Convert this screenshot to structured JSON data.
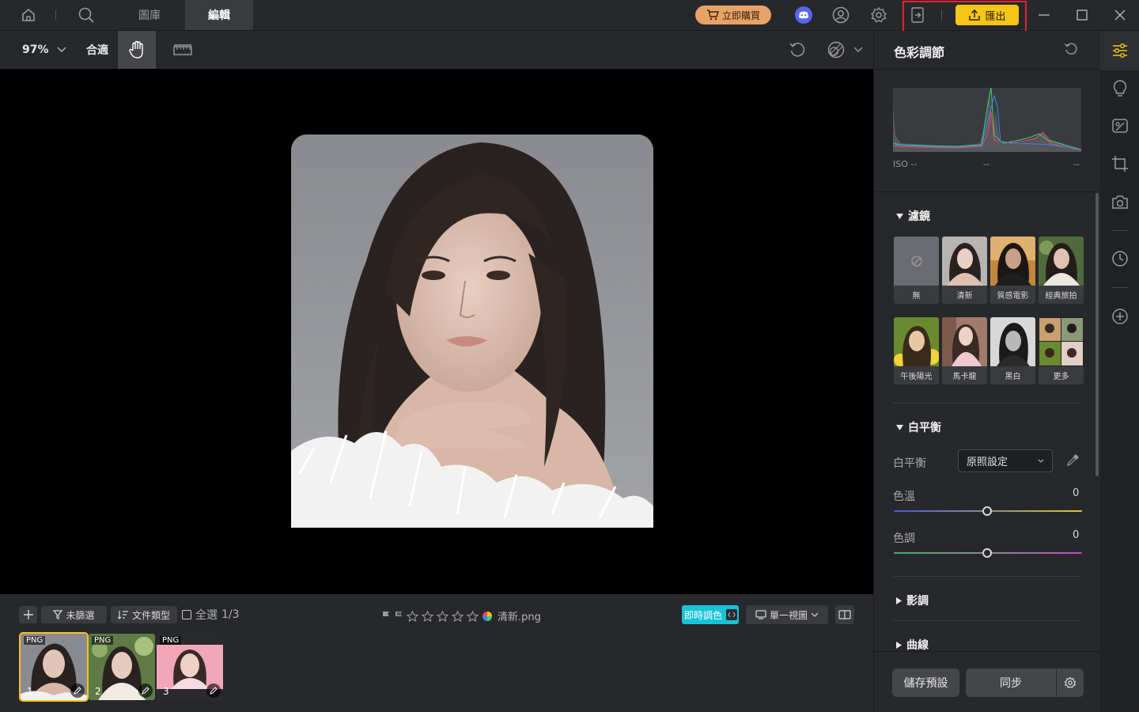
{
  "topbar": {
    "tabs": [
      {
        "label": "圖庫"
      },
      {
        "label": "編輯"
      }
    ],
    "buy_label": "立即購買",
    "export_label": "匯出"
  },
  "toolbar": {
    "zoom": "97%",
    "fit_label": "合適"
  },
  "bottom": {
    "filter_label": "未篩選",
    "filetype_label": "文件類型",
    "select_all_label": "全選",
    "select_count": "1/3",
    "filename": "清新.png",
    "live_color_label": "即時調色",
    "view_label": "單一視圖",
    "thumbnails": [
      {
        "tag": "PNG",
        "num": "1"
      },
      {
        "tag": "PNG",
        "num": "2"
      },
      {
        "tag": "PNG",
        "num": "3"
      }
    ]
  },
  "panel": {
    "title": "色彩調節",
    "iso_label": "ISO --",
    "hist_mid": "--",
    "hist_right": "--",
    "filters_title": "濾鏡",
    "filters": [
      {
        "label": "無"
      },
      {
        "label": "清新"
      },
      {
        "label": "質感電影"
      },
      {
        "label": "經典旅拍"
      },
      {
        "label": "午後陽光"
      },
      {
        "label": "馬卡龍"
      },
      {
        "label": "黑白"
      },
      {
        "label": "更多"
      }
    ],
    "wb_title": "白平衡",
    "wb_label": "白平衡",
    "wb_value": "原照設定",
    "temp_label": "色溫",
    "temp_value": "0",
    "tint_label": "色調",
    "tint_value": "0",
    "tone_title": "影調",
    "curve_title": "曲線",
    "save_preset_label": "儲存預設",
    "sync_label": "同步"
  },
  "colors": {
    "accent": "#f5c518",
    "buy": "#e7a366",
    "live": "#19c3d6",
    "highlight": "#e0242a"
  }
}
